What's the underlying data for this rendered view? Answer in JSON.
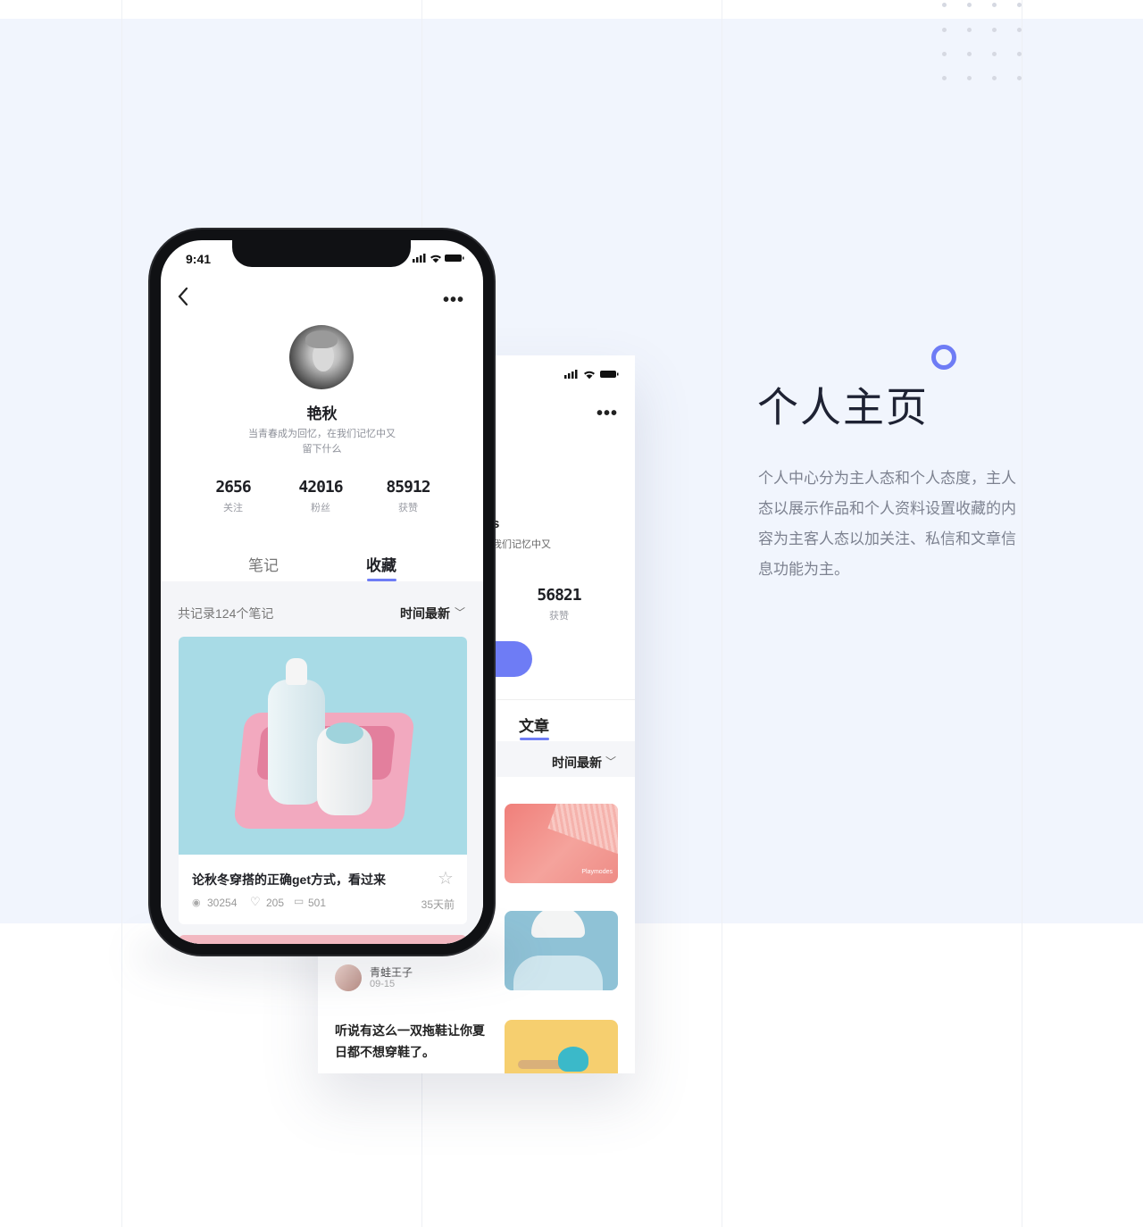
{
  "section": {
    "title": "个人主页",
    "description": "个人中心分为主人态和个人态度，主人态以展示作品和个人资料设置收藏的内容为主客人态以加关注、私信和文章信息功能为主。"
  },
  "phone": {
    "status_time": "9:41",
    "profile": {
      "name": "艳秋",
      "bio_line1": "当青春成为回忆，在我们记忆中又",
      "bio_line2": "留下什么"
    },
    "stats": [
      {
        "value": "2656",
        "label": "关注"
      },
      {
        "value": "42016",
        "label": "粉丝"
      },
      {
        "value": "85912",
        "label": "获赞"
      }
    ],
    "tabs": [
      {
        "label": "笔记"
      },
      {
        "label": "收藏"
      }
    ],
    "record_count": "共记录124个笔记",
    "sort_label": "时间最新",
    "card": {
      "title": "论秋冬穿搭的正确get方式，看过来",
      "views": "30254",
      "likes": "205",
      "comments": "501",
      "time": "35天前"
    }
  },
  "back_screen": {
    "name_fragment": "s",
    "bio_fragment": "我们记忆中又",
    "stat": {
      "value": "56821",
      "label": "获赞"
    },
    "tab": "文章",
    "sort_label": "时间最新",
    "thumb1_brand": "Playmodes",
    "author": {
      "name": "青蛙王子",
      "date": "09-15"
    },
    "article_line1": "听说有这么一双拖鞋让你夏",
    "article_line2": "日都不想穿鞋了。"
  },
  "colors": {
    "accent": "#6e7cf5",
    "band": "#f1f5fd"
  }
}
